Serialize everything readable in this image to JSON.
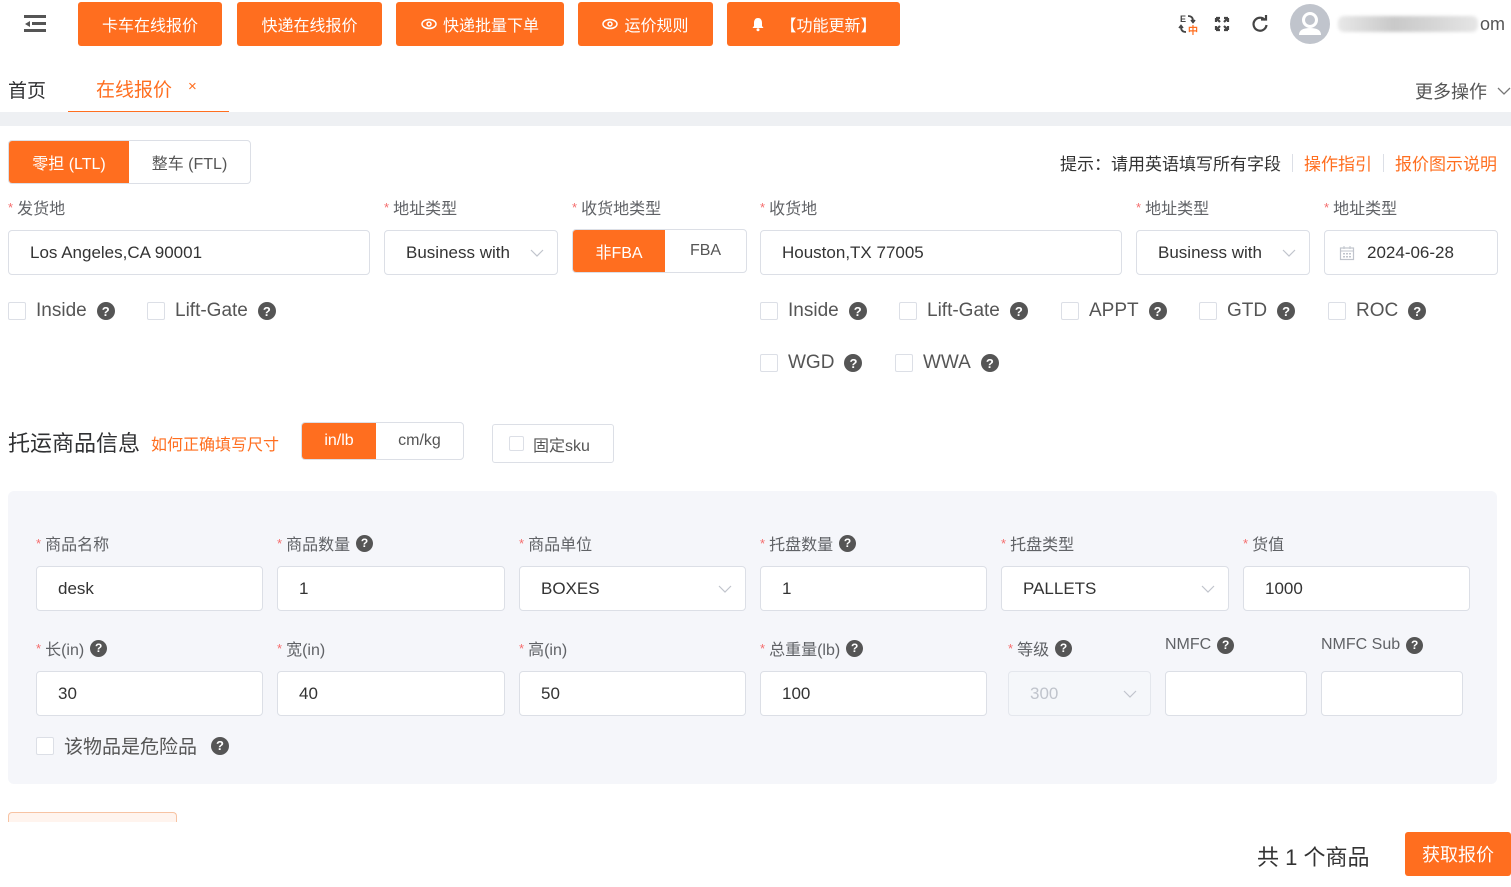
{
  "header": {
    "menu_icon": "menu-fold-icon",
    "buttons": [
      {
        "label": "卡车在线报价",
        "icon": ""
      },
      {
        "label": "快递在线报价",
        "icon": ""
      },
      {
        "label": "快递批量下单",
        "icon": "eye-icon"
      },
      {
        "label": "运价规则",
        "icon": "eye-icon"
      },
      {
        "label": "【功能更新】",
        "icon": "bell-icon"
      }
    ],
    "tools": [
      "translate-icon",
      "fullscreen-icon",
      "refresh-icon"
    ],
    "user": {
      "name_visible_suffix": "om",
      "avatar_icon": "user-avatar-icon"
    }
  },
  "tabs": {
    "home": "首页",
    "active": "在线报价",
    "close_glyph": "×",
    "more_ops": "更多操作"
  },
  "mode": {
    "options": [
      "零担 (LTL)",
      "整车 (FTL)"
    ],
    "selected": "零担 (LTL)"
  },
  "hint": {
    "text": "提示：请用英语填写所有字段",
    "links": [
      "操作指引",
      "报价图示说明"
    ]
  },
  "origin": {
    "label": "发货地",
    "value": "Los Angeles,CA 90001",
    "addr_type_label": "地址类型",
    "addr_type_value": "Business with",
    "dest_type_label": "收货地类型",
    "dest_type_options": [
      "非FBA",
      "FBA"
    ],
    "dest_type_selected": "非FBA",
    "options": [
      "Inside",
      "Lift-Gate"
    ]
  },
  "destination": {
    "label": "收货地",
    "value": "Houston,TX 77005",
    "addr_type_label": "地址类型",
    "addr_type_value": "Business with",
    "date_label": "地址类型",
    "date_value": "2024-06-28",
    "options_row1": [
      "Inside",
      "Lift-Gate",
      "APPT",
      "GTD",
      "ROC"
    ],
    "options_row2": [
      "WGD",
      "WWA"
    ]
  },
  "goods": {
    "title": "托运商品信息",
    "help_link": "如何正确填写尺寸",
    "units": [
      "in/lb",
      "cm/kg"
    ],
    "unit_selected": "in/lb",
    "fixed_sku": "固定sku",
    "row1": [
      {
        "label": "商品名称",
        "value": "desk",
        "required": true,
        "help": false,
        "type": "input"
      },
      {
        "label": "商品数量",
        "value": "1",
        "required": true,
        "help": true,
        "type": "input"
      },
      {
        "label": "商品单位",
        "value": "BOXES",
        "required": true,
        "help": false,
        "type": "select"
      },
      {
        "label": "托盘数量",
        "value": "1",
        "required": true,
        "help": true,
        "type": "input"
      },
      {
        "label": "托盘类型",
        "value": "PALLETS",
        "required": true,
        "help": false,
        "type": "select"
      },
      {
        "label": "货值",
        "value": "1000",
        "required": true,
        "help": false,
        "type": "input"
      }
    ],
    "row2": [
      {
        "label": "长(in)",
        "value": "30",
        "required": true,
        "help": true
      },
      {
        "label": "宽(in)",
        "value": "40",
        "required": true,
        "help": false
      },
      {
        "label": "高(in)",
        "value": "50",
        "required": true,
        "help": false
      },
      {
        "label": "总重量(lb)",
        "value": "100",
        "required": true,
        "help": true
      },
      {
        "label": "等级",
        "value": "300",
        "required": true,
        "help": true,
        "disabled": true
      },
      {
        "label": "NMFC",
        "value": "",
        "required": false,
        "help": true
      },
      {
        "label": "NMFC Sub",
        "value": "",
        "required": false,
        "help": true
      }
    ],
    "hazmat": "该物品是危险品"
  },
  "footer": {
    "total": "共 1 个商品",
    "submit": "获取报价"
  },
  "colors": {
    "accent": "#ff6e1f",
    "required": "#f56c6c",
    "panel_bg": "#f5f6fa"
  }
}
